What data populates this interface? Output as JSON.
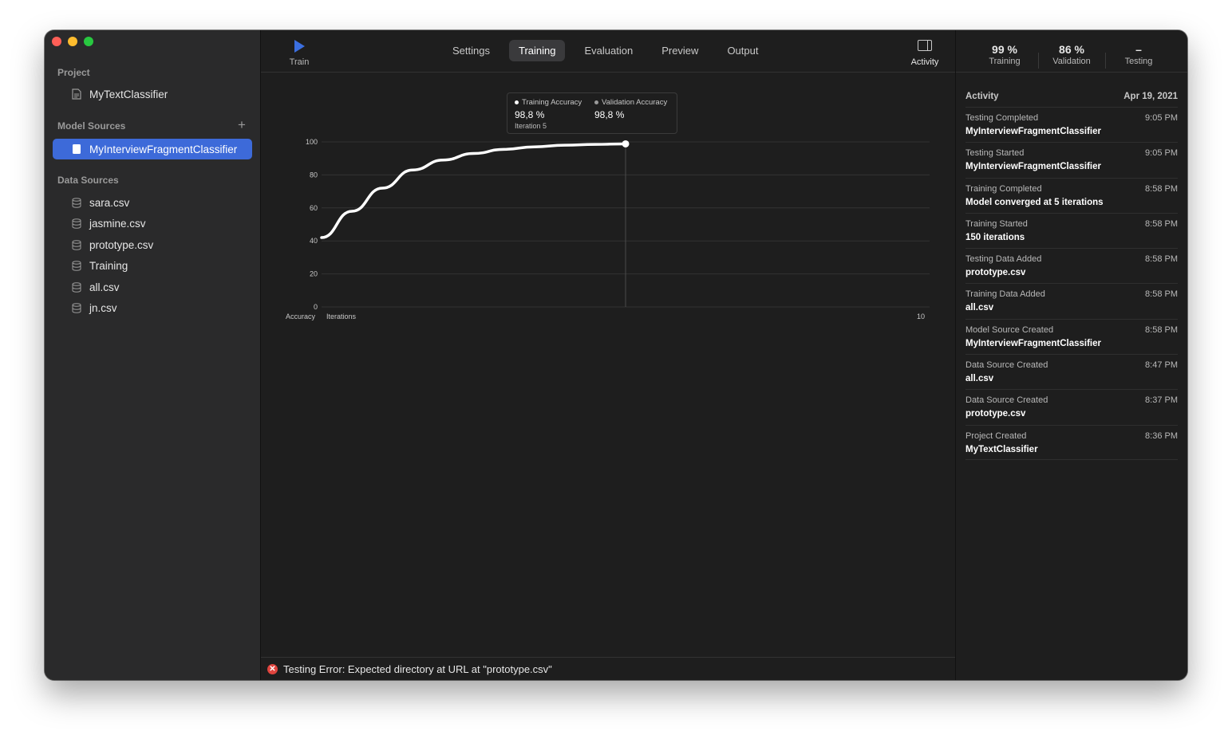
{
  "sidebar": {
    "project_title": "Project",
    "project_item": "MyTextClassifier",
    "model_sources_title": "Model Sources",
    "add_label": "+",
    "model_item": "MyInterviewFragmentClassifier",
    "data_sources_title": "Data Sources",
    "data_items": [
      "sara.csv",
      "jasmine.csv",
      "prototype.csv",
      "Training",
      "all.csv",
      "jn.csv"
    ]
  },
  "toolbar": {
    "train_label": "Train",
    "tabs": [
      "Settings",
      "Training",
      "Evaluation",
      "Preview",
      "Output"
    ],
    "active_tab": "Training",
    "activity_label": "Activity"
  },
  "metrics": {
    "training": {
      "value": "99 %",
      "label": "Training"
    },
    "validation": {
      "value": "86 %",
      "label": "Validation"
    },
    "testing": {
      "value": "–",
      "label": "Testing"
    }
  },
  "legend": {
    "training_label": "Training Accuracy",
    "training_value": "98,8 %",
    "iteration": "Iteration 5",
    "validation_label": "Validation Accuracy",
    "validation_value": "98,8 %"
  },
  "chart_data": {
    "type": "line",
    "xlabel": "Iterations",
    "ylabel": "Accuracy",
    "x_max_label": "10",
    "xlim": [
      0,
      10
    ],
    "ylim": [
      0,
      100
    ],
    "y_ticks": [
      0,
      20,
      40,
      60,
      80,
      100
    ],
    "series": [
      {
        "name": "Training Accuracy",
        "x": [
          0,
          0.5,
          1,
          1.5,
          2,
          2.5,
          3,
          3.5,
          4,
          4.5,
          5
        ],
        "y": [
          42,
          58,
          72,
          83,
          89,
          93,
          95.5,
          97,
          98,
          98.5,
          98.8
        ]
      }
    ],
    "highlight": {
      "x": 5,
      "y": 98.8
    },
    "colors": {
      "line": "#ffffff",
      "grid": "#333333",
      "axis_text": "#c8c8c8"
    }
  },
  "error": {
    "text": "Testing Error: Expected directory at URL at \"prototype.csv\""
  },
  "activity": {
    "title": "Activity",
    "date": "Apr 19, 2021",
    "items": [
      {
        "title": "Testing Completed",
        "time": "9:05 PM",
        "detail": "MyInterviewFragmentClassifier"
      },
      {
        "title": "Testing Started",
        "time": "9:05 PM",
        "detail": "MyInterviewFragmentClassifier"
      },
      {
        "title": "Training Completed",
        "time": "8:58 PM",
        "detail": "Model converged at 5 iterations"
      },
      {
        "title": "Training Started",
        "time": "8:58 PM",
        "detail": "150 iterations"
      },
      {
        "title": "Testing Data Added",
        "time": "8:58 PM",
        "detail": "prototype.csv"
      },
      {
        "title": "Training Data Added",
        "time": "8:58 PM",
        "detail": "all.csv"
      },
      {
        "title": "Model Source Created",
        "time": "8:58 PM",
        "detail": "MyInterviewFragmentClassifier"
      },
      {
        "title": "Data Source Created",
        "time": "8:47 PM",
        "detail": "all.csv"
      },
      {
        "title": "Data Source Created",
        "time": "8:37 PM",
        "detail": "prototype.csv"
      },
      {
        "title": "Project Created",
        "time": "8:36 PM",
        "detail": "MyTextClassifier"
      }
    ]
  },
  "colors": {
    "accent": "#3d6ad9",
    "error": "#e0443e"
  }
}
